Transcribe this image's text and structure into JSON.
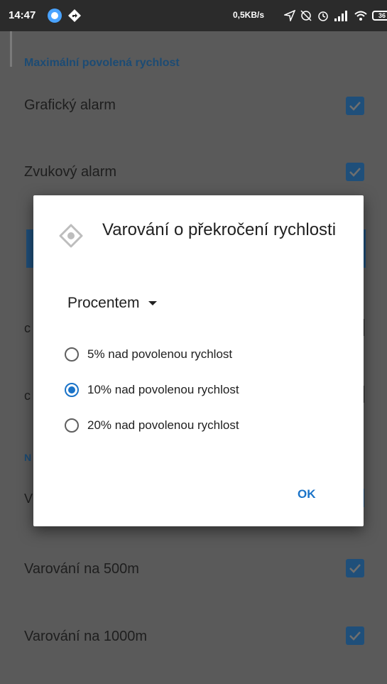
{
  "status_bar": {
    "time": "14:47",
    "network_speed": "0,5KB/s",
    "battery": "36"
  },
  "settings": {
    "section1_title": "Maximální povolená rychlost",
    "graphic_alarm": "Grafický alarm",
    "sound_alarm": "Zvukový alarm",
    "peek_c1": "c",
    "peek_c2": "c",
    "peek_n": "N",
    "peek_v": "V",
    "warning_500": "Varování na 500m",
    "warning_1000": "Varování na 1000m"
  },
  "dialog": {
    "title": "Varování o překročení rychlosti",
    "dropdown_value": "Procentem",
    "options": [
      {
        "label": "5% nad povolenou rychlost",
        "checked": false
      },
      {
        "label": "10% nad povolenou rychlost",
        "checked": true
      },
      {
        "label": "20% nad povolenou rychlost",
        "checked": false
      }
    ],
    "ok_label": "OK"
  },
  "colors": {
    "accent": "#1a73c8",
    "checkbox": "#1f4f7a",
    "scrim": "#5a5a5a"
  }
}
